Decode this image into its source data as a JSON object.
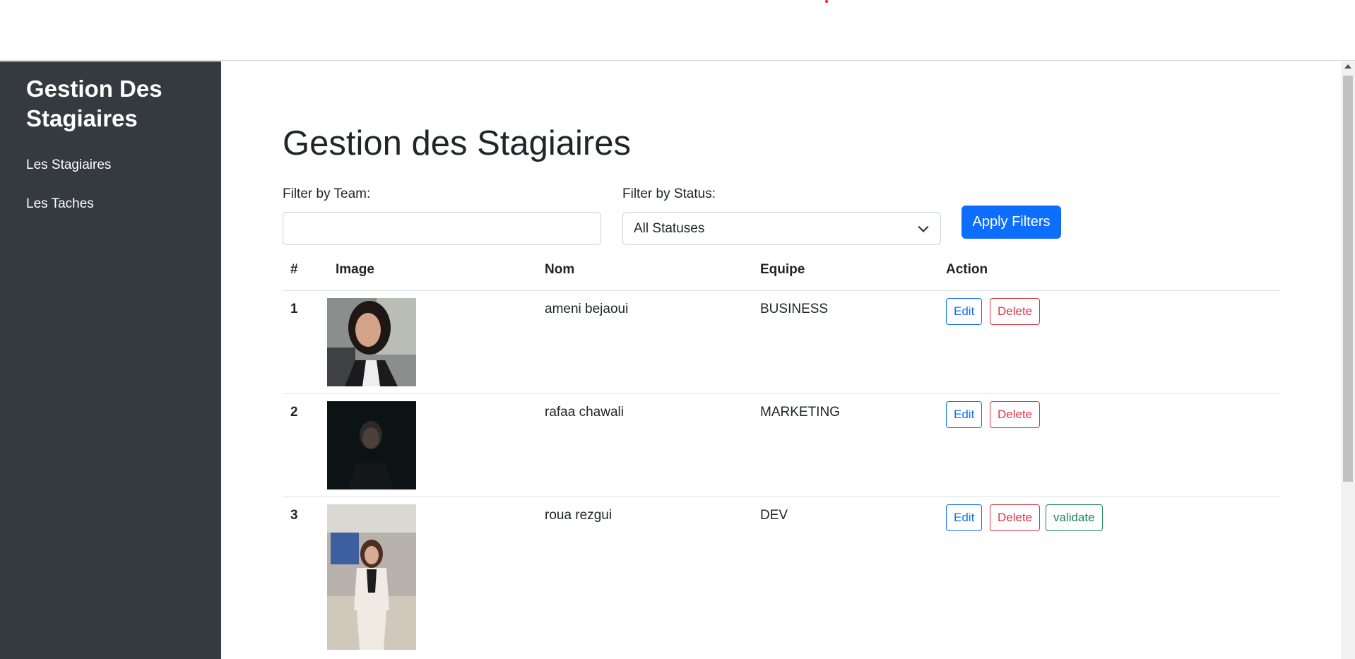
{
  "sidebar": {
    "brand": "Gestion Des Stagiaires",
    "items": [
      {
        "label": "Les Stagiaires"
      },
      {
        "label": "Les Taches"
      }
    ]
  },
  "main": {
    "title": "Gestion des Stagiaires",
    "filters": {
      "team_label": "Filter by Team:",
      "team_value": "",
      "status_label": "Filter by Status:",
      "status_selected": "All Statuses",
      "apply_label": "Apply Filters"
    },
    "table": {
      "headers": [
        "#",
        "Image",
        "Nom",
        "Equipe",
        "Action"
      ],
      "rows": [
        {
          "num": "1",
          "nom": "ameni bejaoui",
          "equipe": "BUSINESS",
          "actions": [
            "Edit",
            "Delete"
          ]
        },
        {
          "num": "2",
          "nom": "rafaa chawali",
          "equipe": "MARKETING",
          "actions": [
            "Edit",
            "Delete"
          ]
        },
        {
          "num": "3",
          "nom": "roua rezgui",
          "equipe": "DEV",
          "actions": [
            "Edit",
            "Delete",
            "validate"
          ]
        }
      ]
    }
  },
  "colors": {
    "sidebar_bg": "#343a40",
    "primary": "#0d6efd",
    "danger": "#dc3545",
    "success": "#198754"
  }
}
